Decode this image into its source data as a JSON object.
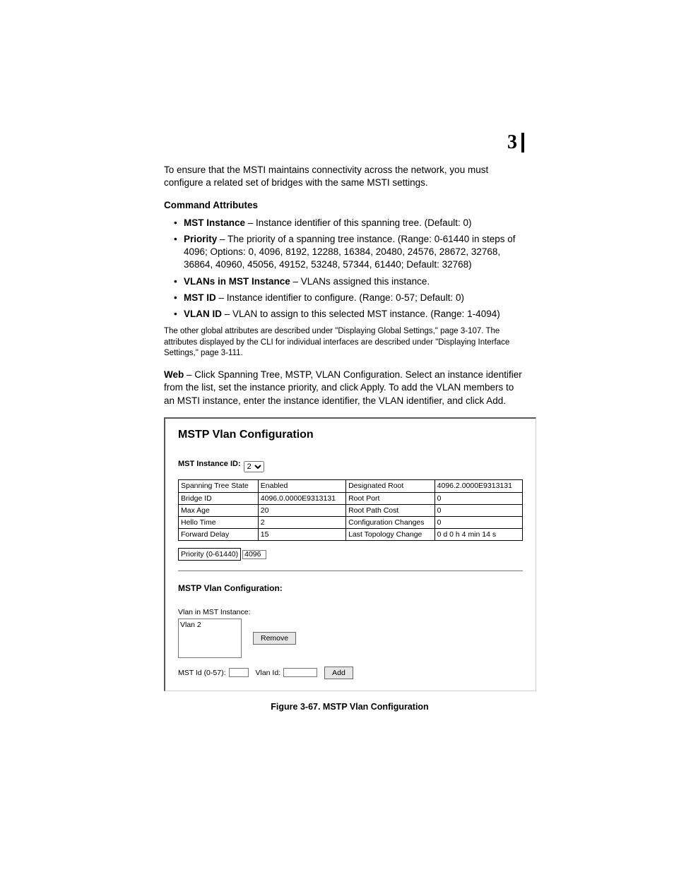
{
  "chapter": "3",
  "intro": "To ensure that the MSTI maintains connectivity across the network, you must configure a related set of bridges with the same MSTI settings.",
  "attrs_heading": "Command Attributes",
  "attrs": [
    {
      "name": "MST Instance",
      "desc": " – Instance identifier of this spanning tree. (Default: 0)"
    },
    {
      "name": "Priority",
      "desc": " – The priority of a spanning tree instance. (Range: 0-61440 in steps of 4096; Options: 0, 4096, 8192, 12288, 16384, 20480, 24576, 28672, 32768, 36864, 40960, 45056, 49152, 53248, 57344, 61440; Default: 32768)"
    },
    {
      "name": "VLANs in MST Instance",
      "desc": " – VLANs assigned this instance."
    },
    {
      "name": "MST ID",
      "desc": " – Instance identifier to configure. (Range: 0-57; Default: 0)"
    },
    {
      "name": "VLAN ID",
      "desc": " – VLAN to assign to this selected MST instance. (Range: 1-4094)"
    }
  ],
  "note": "The other global attributes are described under \"Displaying Global Settings,\" page 3-107. The attributes displayed by the CLI for individual interfaces are described under \"Displaying Interface Settings,\" page 3-111.",
  "web_label": "Web",
  "web_text": " – Click Spanning Tree, MSTP, VLAN Configuration. Select an instance identifier from the list, set the instance priority, and click Apply. To add the VLAN members to an MSTI instance, enter the instance identifier, the VLAN identifier, and click Add.",
  "panel": {
    "title": "MSTP Vlan Configuration",
    "instance_label": "MST Instance ID:",
    "instance_value": "2",
    "status": [
      [
        "Spanning Tree State",
        "Enabled",
        "Designated Root",
        "4096.2.0000E9313131"
      ],
      [
        "Bridge ID",
        "4096.0.0000E9313131",
        "Root Port",
        "0"
      ],
      [
        "Max Age",
        "20",
        "Root Path Cost",
        "0"
      ],
      [
        "Hello Time",
        "2",
        "Configuration Changes",
        "0"
      ],
      [
        "Forward Delay",
        "15",
        "Last Topology Change",
        "0 d 0 h 4 min 14 s"
      ]
    ],
    "priority_label": "Priority (0-61440)",
    "priority_value": "4096",
    "subtitle": "MSTP Vlan Configuration:",
    "vlan_in_label": "Vlan in MST Instance:",
    "vlan_item": "Vlan 2",
    "remove_btn": "Remove",
    "mst_id_label": "MST Id (0-57):",
    "vlan_id_label": "Vlan Id:",
    "add_btn": "Add"
  },
  "figure_caption": "Figure 3-67.  MSTP Vlan Configuration"
}
